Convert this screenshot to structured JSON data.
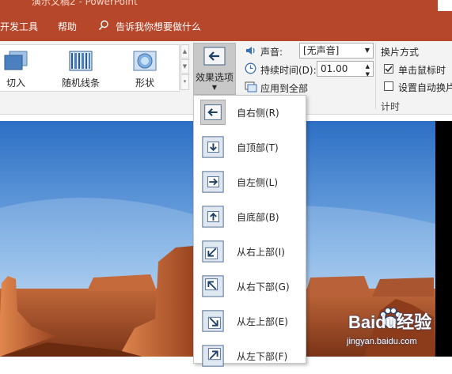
{
  "titlebar": {
    "title": "演示文稿2 - PowerPoint"
  },
  "tabs": {
    "developer": "开发工具",
    "help": "帮助",
    "tell_me": "告诉我你想要做什么"
  },
  "gallery": {
    "items": [
      {
        "label": "切入",
        "icon": "cut-in-transition-icon"
      },
      {
        "label": "随机线条",
        "icon": "random-bars-transition-icon"
      },
      {
        "label": "形状",
        "icon": "shape-transition-icon"
      }
    ]
  },
  "effect_options": {
    "label": "效果选项",
    "icon": "from-right-arrow-icon"
  },
  "timing": {
    "sound_label": "声音:",
    "sound_value": "[无声音]",
    "duration_label": "持续时间(D):",
    "duration_value": "01.00",
    "apply_all_label": "应用到全部",
    "advance_label": "换片方式",
    "on_click_label": "单击鼠标时",
    "on_click_checked": true,
    "after_label": "设置自动换片",
    "after_checked": false,
    "group_label": "计时"
  },
  "dropdown": {
    "selected_index": 0,
    "items": [
      {
        "label": "自右侧(R)",
        "icon": "arrow-left-icon"
      },
      {
        "label": "自顶部(T)",
        "icon": "arrow-down-icon"
      },
      {
        "label": "自左侧(L)",
        "icon": "arrow-right-icon"
      },
      {
        "label": "自底部(B)",
        "icon": "arrow-up-icon"
      },
      {
        "label": "从右上部(I)",
        "icon": "arrow-down-left-icon"
      },
      {
        "label": "从右下部(G)",
        "icon": "arrow-up-left-icon"
      },
      {
        "label": "从左上部(E)",
        "icon": "arrow-down-right-icon"
      },
      {
        "label": "从左下部(F)",
        "icon": "arrow-up-right-icon"
      }
    ]
  },
  "watermark": {
    "main": "Baidu经验",
    "sub": "jingyan.baidu.com"
  },
  "colors": {
    "accent": "#b7472a",
    "ribbon": "#f3f3f3",
    "selected": "#c8c8c8"
  }
}
